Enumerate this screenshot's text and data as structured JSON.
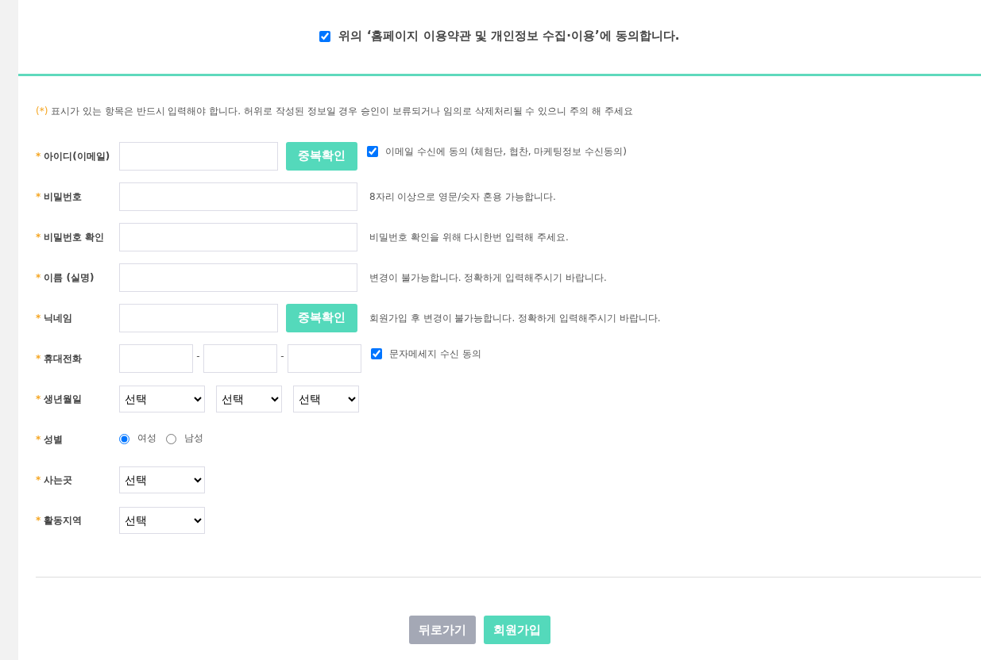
{
  "agreement": {
    "checked": true,
    "label": "위의 ‘홈페이지 이용약관 및 개인정보 수집·이용’에 동의합니다."
  },
  "notice": {
    "mark": "(*)",
    "text": "표시가 있는 항목은 반드시 입력해야 합니다. 허위로 작성된 정보일 경우 승인이 보류되거나 임의로 삭제처리될 수 있으니 주의 해 주세요"
  },
  "fields": [
    {
      "kind": "text_button",
      "mark": "*",
      "label": "아이디(이메일)",
      "button": "중복확인",
      "consent": {
        "checked": true,
        "label": "이메일 수신에 동의 (체험단, 협찬, 마케팅정보 수신동의)"
      }
    },
    {
      "kind": "text",
      "mark": "*",
      "label": "비밀번호",
      "hint": "8자리 이상으로 영문/숫자 혼용 가능합니다."
    },
    {
      "kind": "text",
      "mark": "*",
      "label": "비밀번호 확인",
      "hint": "비밀번호 확인을 위해 다시한번 입력해 주세요."
    },
    {
      "kind": "text",
      "mark": "*",
      "label": "이름 (실명)",
      "hint": "변경이 불가능합니다. 정확하게 입력해주시기 바랍니다."
    },
    {
      "kind": "text_button",
      "mark": "*",
      "label": "닉네임",
      "button": "중복확인",
      "hint": "회원가입 후 변경이 불가능합니다. 정확하게 입력해주시기 바랍니다."
    },
    {
      "kind": "phone",
      "mark": "*",
      "label": "휴대전화",
      "separators": [
        "-",
        "-"
      ],
      "consent": {
        "checked": true,
        "label": "문자메세지 수신 동의"
      }
    },
    {
      "kind": "selects",
      "mark": "*",
      "label": "생년월일",
      "selects": [
        "선택",
        "선택",
        "선택"
      ]
    },
    {
      "kind": "radio",
      "mark": "*",
      "label": "성별",
      "options": [
        {
          "label": "여성",
          "selected": true
        },
        {
          "label": "남성",
          "selected": false
        }
      ]
    },
    {
      "kind": "selects",
      "mark": "*",
      "label": "사는곳",
      "selects": [
        "선택"
      ]
    },
    {
      "kind": "selects",
      "mark": "*",
      "label": "활동지역",
      "selects": [
        "선택"
      ]
    }
  ],
  "buttons": [
    {
      "kind": "back",
      "label": "뒤로가기"
    },
    {
      "kind": "submit",
      "label": "회원가입"
    }
  ]
}
